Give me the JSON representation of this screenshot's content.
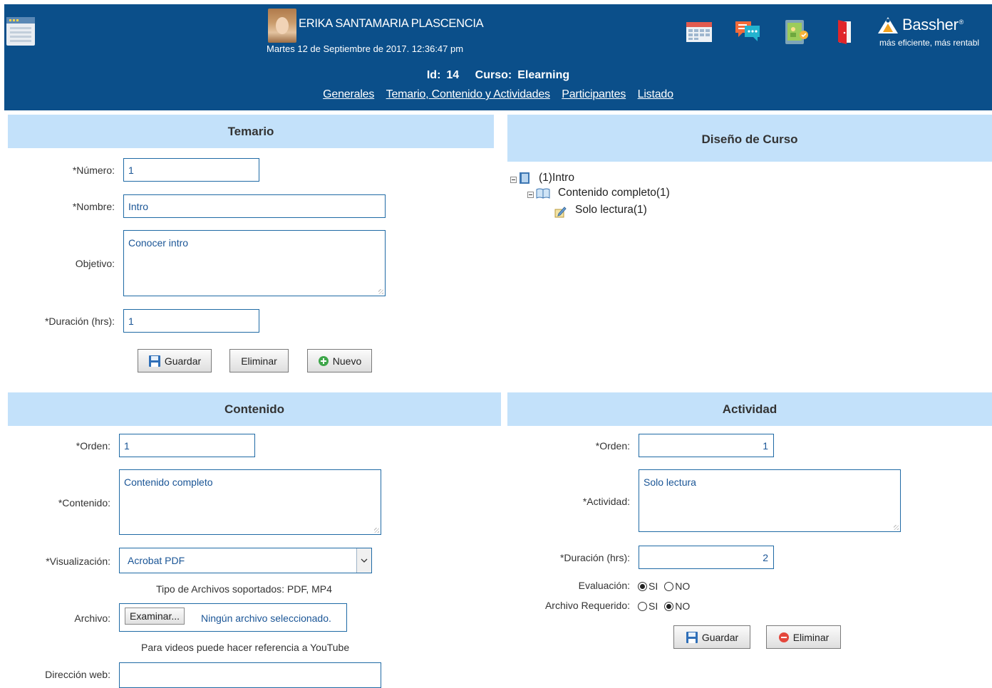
{
  "header": {
    "user_name": "ERIKA SANTAMARIA PLASCENCIA",
    "datetime": "Martes 12 de Septiembre de 2017. 12:36:47 pm",
    "brand_name": "Bassher",
    "brand_mark": "®",
    "brand_tagline": "más eficiente, más rentabl",
    "course_id_label": "Id:",
    "course_id": "14",
    "course_label": "Curso:",
    "course_name": "Elearning",
    "nav": [
      "Generales",
      "Temario, Contenido y Actividades",
      "Participantes",
      "Listado"
    ],
    "icons": [
      "menu-icon",
      "calendar-icon",
      "chat-icon",
      "tablet-icon",
      "exit-door-icon",
      "bassher-logo-icon"
    ]
  },
  "temario": {
    "title": "Temario",
    "numero_label": "*Número:",
    "numero_value": "1",
    "nombre_label": "*Nombre:",
    "nombre_value": "Intro",
    "objetivo_label": "Objetivo:",
    "objetivo_value": "Conocer intro",
    "duracion_label": "*Duración (hrs):",
    "duracion_value": "1",
    "guardar_label": "Guardar",
    "eliminar_label": "Eliminar",
    "nuevo_label": "Nuevo"
  },
  "diseno": {
    "title": "Diseño de Curso",
    "tree": [
      {
        "label": "(1)Intro",
        "icon": "book-icon"
      },
      {
        "label": "Contenido completo(1)",
        "icon": "open-book-icon"
      },
      {
        "label": "Solo lectura(1)",
        "icon": "pencil-note-icon"
      }
    ]
  },
  "contenido": {
    "title": "Contenido",
    "orden_label": "*Orden:",
    "orden_value": "1",
    "contenido_label": "*Contenido:",
    "contenido_value": "Contenido completo",
    "visualizacion_label": "*Visualización:",
    "visualizacion_value": "Acrobat PDF",
    "tipos_note": "Tipo de Archivos soportados: PDF, MP4",
    "archivo_label": "Archivo:",
    "examinar_label": "Examinar...",
    "archivo_status": "Ningún archivo seleccionado.",
    "videos_note": "Para videos puede hacer referencia a YouTube",
    "direccion_label": "Dirección web:",
    "direccion_value": ""
  },
  "actividad": {
    "title": "Actividad",
    "orden_label": "*Orden:",
    "orden_value": "1",
    "actividad_label": "*Actividad:",
    "actividad_value": "Solo lectura",
    "duracion_label": "*Duración (hrs):",
    "duracion_value": "2",
    "evaluacion_label": "Evaluación:",
    "evaluacion_selected": "SI",
    "archivo_label": "Archivo Requerido:",
    "archivo_selected": "NO",
    "opt_si": "SI",
    "opt_no": "NO",
    "guardar_label": "Guardar",
    "eliminar_label": "Eliminar"
  }
}
